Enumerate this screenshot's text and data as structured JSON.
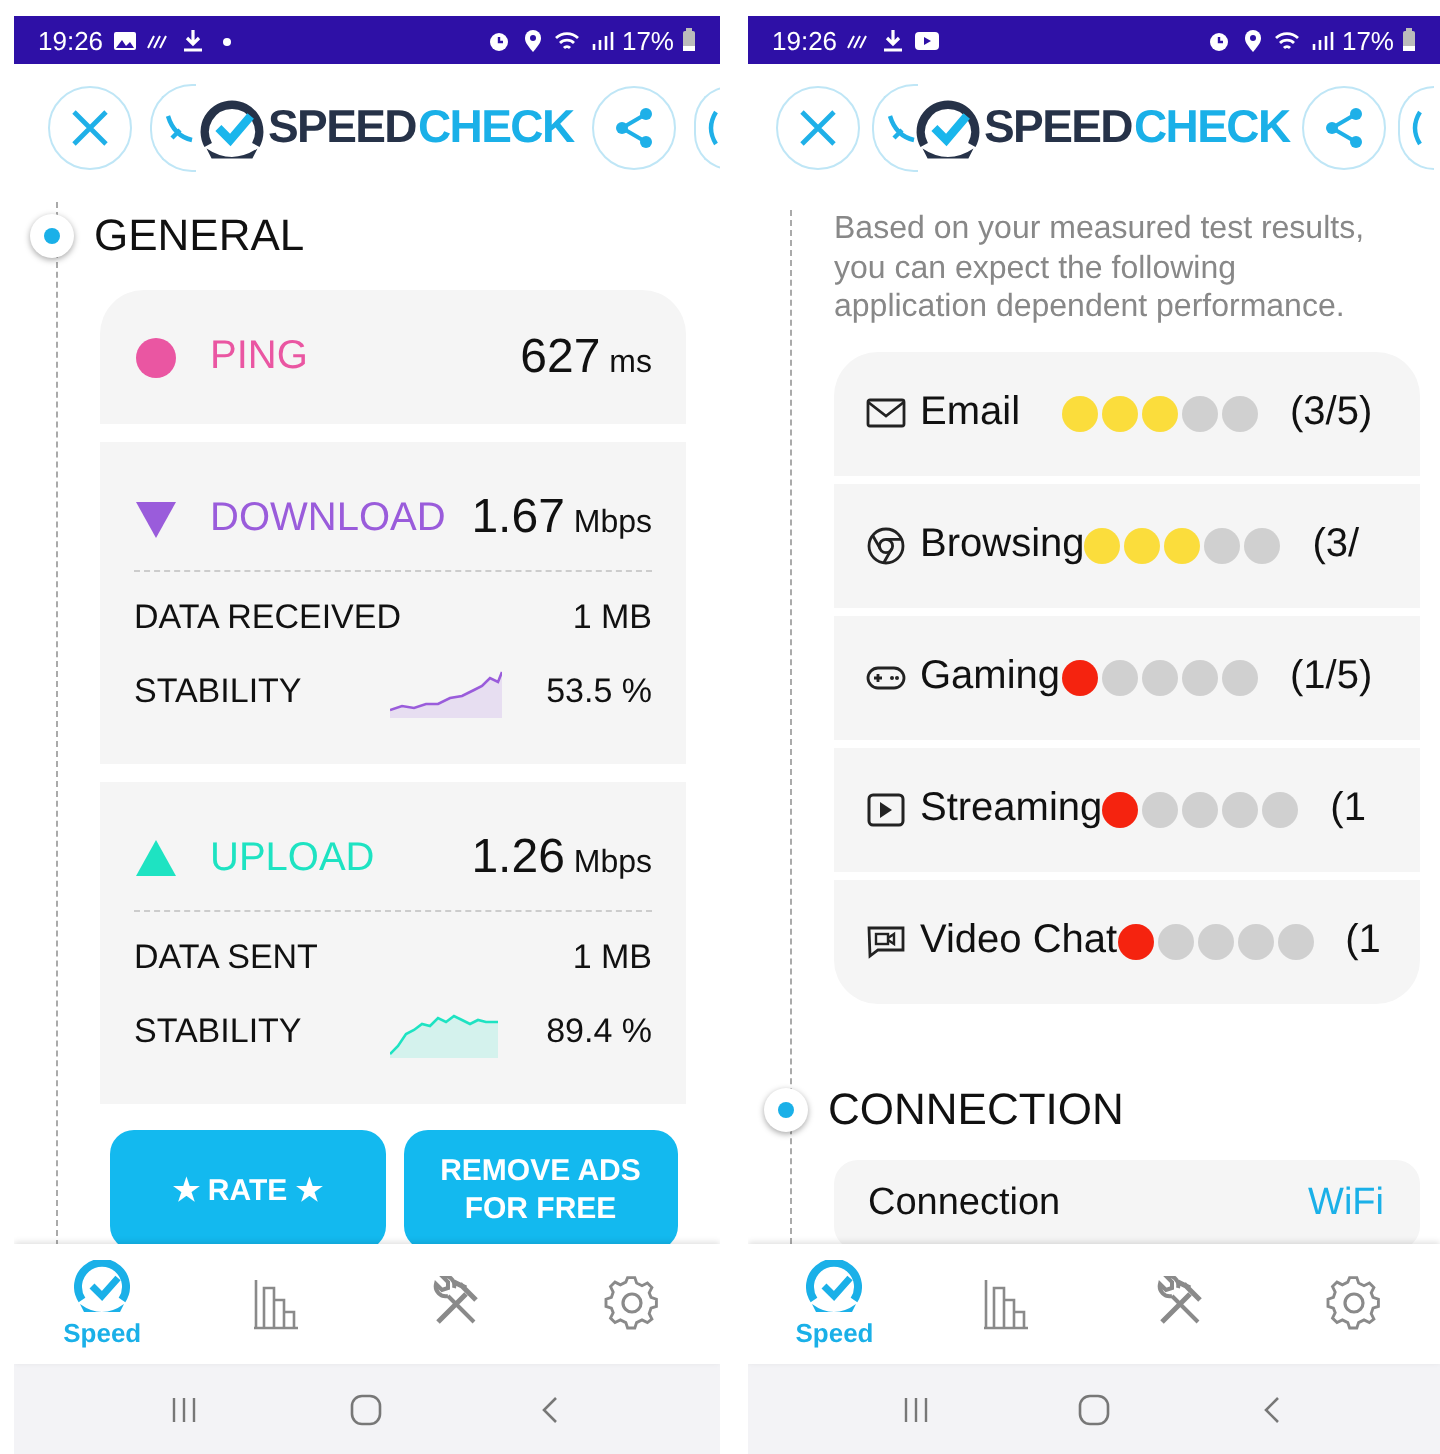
{
  "screens": [
    {
      "status_bar": {
        "time": "19:26",
        "battery": "17%"
      },
      "header": {
        "logo_dark": "SPEED",
        "logo_accent": "CHECK"
      },
      "sections": [
        {
          "kind": "general",
          "heading": "GENERAL",
          "metrics": [
            {
              "kind": "ping",
              "label": "PING",
              "value": "627",
              "unit": "ms",
              "color": "#ea56a2"
            },
            {
              "kind": "download",
              "label": "DOWNLOAD",
              "value": "1.67",
              "unit": "Mbps",
              "color": "#9a5cdb",
              "details": [
                {
                  "kind": "plain",
                  "label": "DATA RECEIVED",
                  "value": "1 MB"
                },
                {
                  "kind": "sparkline",
                  "label": "STABILITY",
                  "value": "53.5 %"
                }
              ]
            },
            {
              "kind": "upload",
              "label": "UPLOAD",
              "value": "1.26",
              "unit": "Mbps",
              "color": "#1ee3c2",
              "details": [
                {
                  "kind": "plain",
                  "label": "DATA SENT",
                  "value": "1 MB"
                },
                {
                  "kind": "sparkline",
                  "label": "STABILITY",
                  "value": "89.4 %"
                }
              ]
            }
          ],
          "buttons": [
            "★ RATE ★",
            "REMOVE ADS FOR FREE"
          ]
        }
      ],
      "nav": [
        {
          "kind": "speed",
          "label": "Speed",
          "selected": true
        },
        {
          "kind": "history",
          "selected": false
        },
        {
          "kind": "tools",
          "selected": false
        },
        {
          "kind": "settings",
          "selected": false
        }
      ]
    },
    {
      "status_bar": {
        "time": "19:26",
        "battery": "17%"
      },
      "header": {
        "logo_dark": "SPEED",
        "logo_accent": "CHECK"
      },
      "sections": [
        {
          "kind": "apps",
          "intro": "Based on your measured test results, you can expect the following application dependent performance.",
          "apps": [
            {
              "kind": "email",
              "label": "Email",
              "stars": 3,
              "color": "#fbdd3c",
              "count": "(3/5)"
            },
            {
              "kind": "browsing",
              "label": "Browsing",
              "stars": 3,
              "color": "#fbdd3c",
              "count": "(3/"
            },
            {
              "kind": "gaming",
              "label": "Gaming",
              "stars": 1,
              "color": "#f5230f",
              "count": "(1/5)"
            },
            {
              "kind": "streaming",
              "label": "Streaming",
              "stars": 1,
              "color": "#f5230f",
              "count": "(1"
            },
            {
              "kind": "video",
              "label": "Video Chat",
              "stars": 1,
              "color": "#f5230f",
              "count": "(1"
            }
          ]
        },
        {
          "kind": "connection",
          "heading": "CONNECTION",
          "rows": [
            {
              "label": "Connection",
              "value": "WiFi"
            }
          ]
        }
      ],
      "nav": [
        {
          "kind": "speed",
          "label": "Speed",
          "selected": true
        },
        {
          "kind": "history",
          "selected": false
        },
        {
          "kind": "tools",
          "selected": false
        },
        {
          "kind": "settings",
          "selected": false
        }
      ]
    }
  ]
}
